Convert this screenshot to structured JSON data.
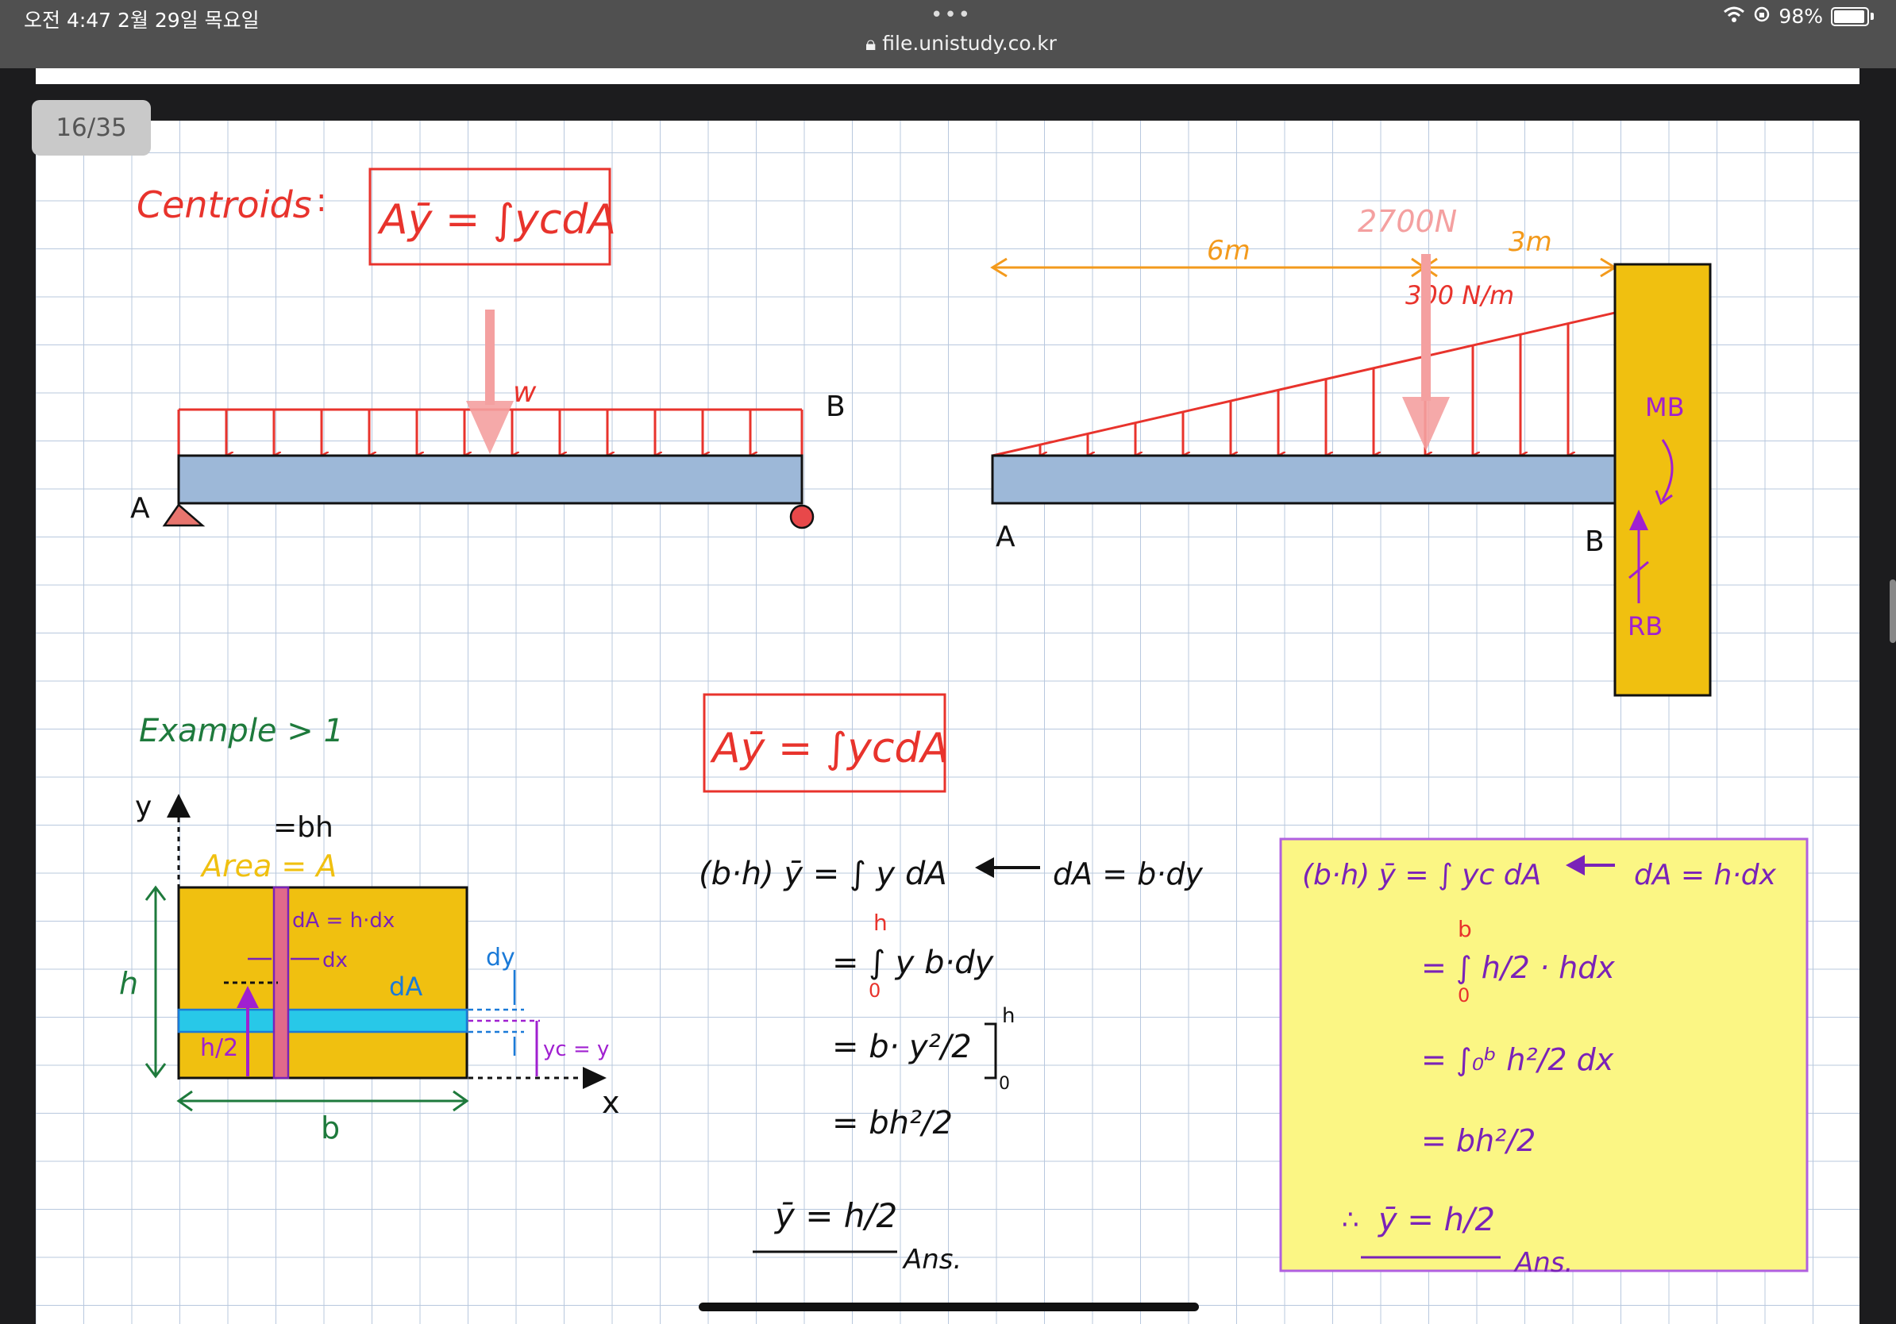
{
  "status_bar": {
    "time_date": "오전 4:47   2월 29일 목요일",
    "url": "file.unistudy.co.kr",
    "battery": "98%",
    "dots": "•••"
  },
  "page_indicator": "16/35",
  "notes": {
    "heading": "Centroids",
    "colon": ":",
    "formula_top": "Aȳ = ∫ycdA",
    "beam1": {
      "load_label": "w",
      "left": "A",
      "right": "B"
    },
    "beam2": {
      "dist_left": "6m",
      "dist_right": "3m",
      "resultant": "2700N",
      "intensity": "300 N/m",
      "moment": "MB",
      "reaction": "RB",
      "left": "A",
      "right": "B"
    },
    "example_title": "Example > 1",
    "diagram": {
      "y_axis": "y",
      "x_axis": "x",
      "eq_bh": "=bh",
      "area_label": "Area = A",
      "dA_hdx": "dA = h·dx",
      "dx": "dx",
      "dy": "dy",
      "dA": "dA",
      "h": "h",
      "h_over_2": "h/2",
      "yc_y": "yc = y",
      "b": "b"
    },
    "formula_mid": "Aȳ = ∫ycdA",
    "derivation_mid": {
      "line1": "(b·h) ȳ = ∫ y dA",
      "line1_right": "dA = b·dy",
      "upper_limit": "h",
      "lower_limit": "0",
      "line2": "= ∫ y b·dy",
      "line3": "= b· y²/2",
      "bracket_upper": "h",
      "bracket_lower": "0",
      "line4": "= bh²/2",
      "result": "ȳ = h/2",
      "ans": "Ans."
    },
    "derivation_right": {
      "line1": "(b·h) ȳ = ∫ yc dA",
      "line1_right": "dA = h·dx",
      "upper_limit": "b",
      "lower_limit": "0",
      "line2": "= ∫ h/2 · hdx",
      "line3": "= ∫₀ᵇ h²/2 dx",
      "line4": "= bh²/2",
      "therefore": "∴",
      "result": "ȳ = h/2",
      "ans": "Ans."
    }
  },
  "colors": {
    "red": "#e8332c",
    "orange": "#f39a1c",
    "yellow": "#f0c010",
    "beam_blue": "#9db8d8",
    "purple": "#7a22b8",
    "green": "#1e7a3c",
    "blue": "#1a7ad8",
    "cyan": "#28c8e8",
    "pink": "#f4a0a0",
    "highlight": "#fbf684"
  }
}
